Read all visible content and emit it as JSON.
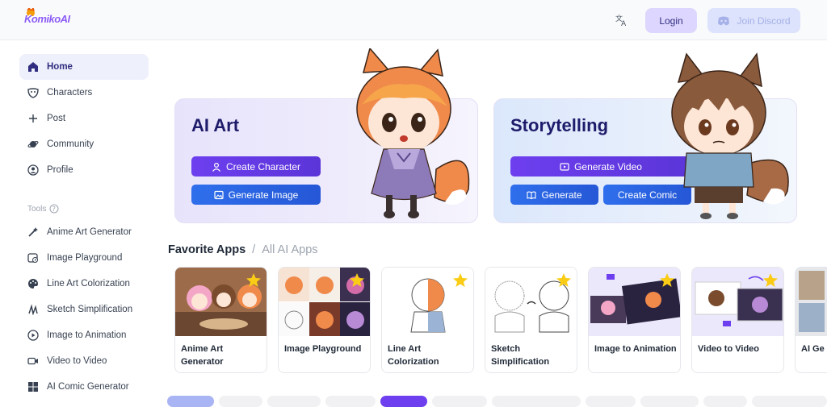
{
  "header": {
    "logo_text": "KomikoAI",
    "login_label": "Login",
    "discord_label": "Join Discord"
  },
  "sidebar": {
    "items": [
      {
        "label": "Home",
        "icon": "home-icon"
      },
      {
        "label": "Characters",
        "icon": "mask-icon"
      },
      {
        "label": "Post",
        "icon": "plus-icon"
      },
      {
        "label": "Community",
        "icon": "planet-icon"
      },
      {
        "label": "Profile",
        "icon": "user-circle-icon"
      }
    ],
    "tools_label": "Tools",
    "tools": [
      {
        "label": "Anime Art Generator",
        "icon": "magic-wand-icon"
      },
      {
        "label": "Image Playground",
        "icon": "image-play-icon"
      },
      {
        "label": "Line Art Colorization",
        "icon": "palette-icon"
      },
      {
        "label": "Sketch Simplification",
        "icon": "sketch-icon"
      },
      {
        "label": "Image to Animation",
        "icon": "play-circle-icon"
      },
      {
        "label": "Video to Video",
        "icon": "video-icon"
      },
      {
        "label": "AI Comic Generator",
        "icon": "comic-grid-icon"
      }
    ]
  },
  "hero": {
    "art": {
      "title": "AI Art",
      "create_character": "Create Character",
      "generate_image": "Generate Image"
    },
    "story": {
      "title": "Storytelling",
      "generate_video": "Generate Video",
      "generate": "Generate",
      "create_comic": "Create Comic"
    }
  },
  "apps_section": {
    "title": "Favorite Apps",
    "separator": "/",
    "all_link": "All AI Apps",
    "apps": [
      {
        "name": "Anime Art Generator"
      },
      {
        "name": "Image Playground"
      },
      {
        "name": "Line Art Colorization"
      },
      {
        "name": "Sketch Simplification"
      },
      {
        "name": "Image to Animation"
      },
      {
        "name": "Video to Video"
      },
      {
        "name": "AI Ge"
      }
    ]
  },
  "colors": {
    "accent_purple": "#6d3fef",
    "accent_blue": "#2f6fec",
    "star": "#facc15"
  }
}
